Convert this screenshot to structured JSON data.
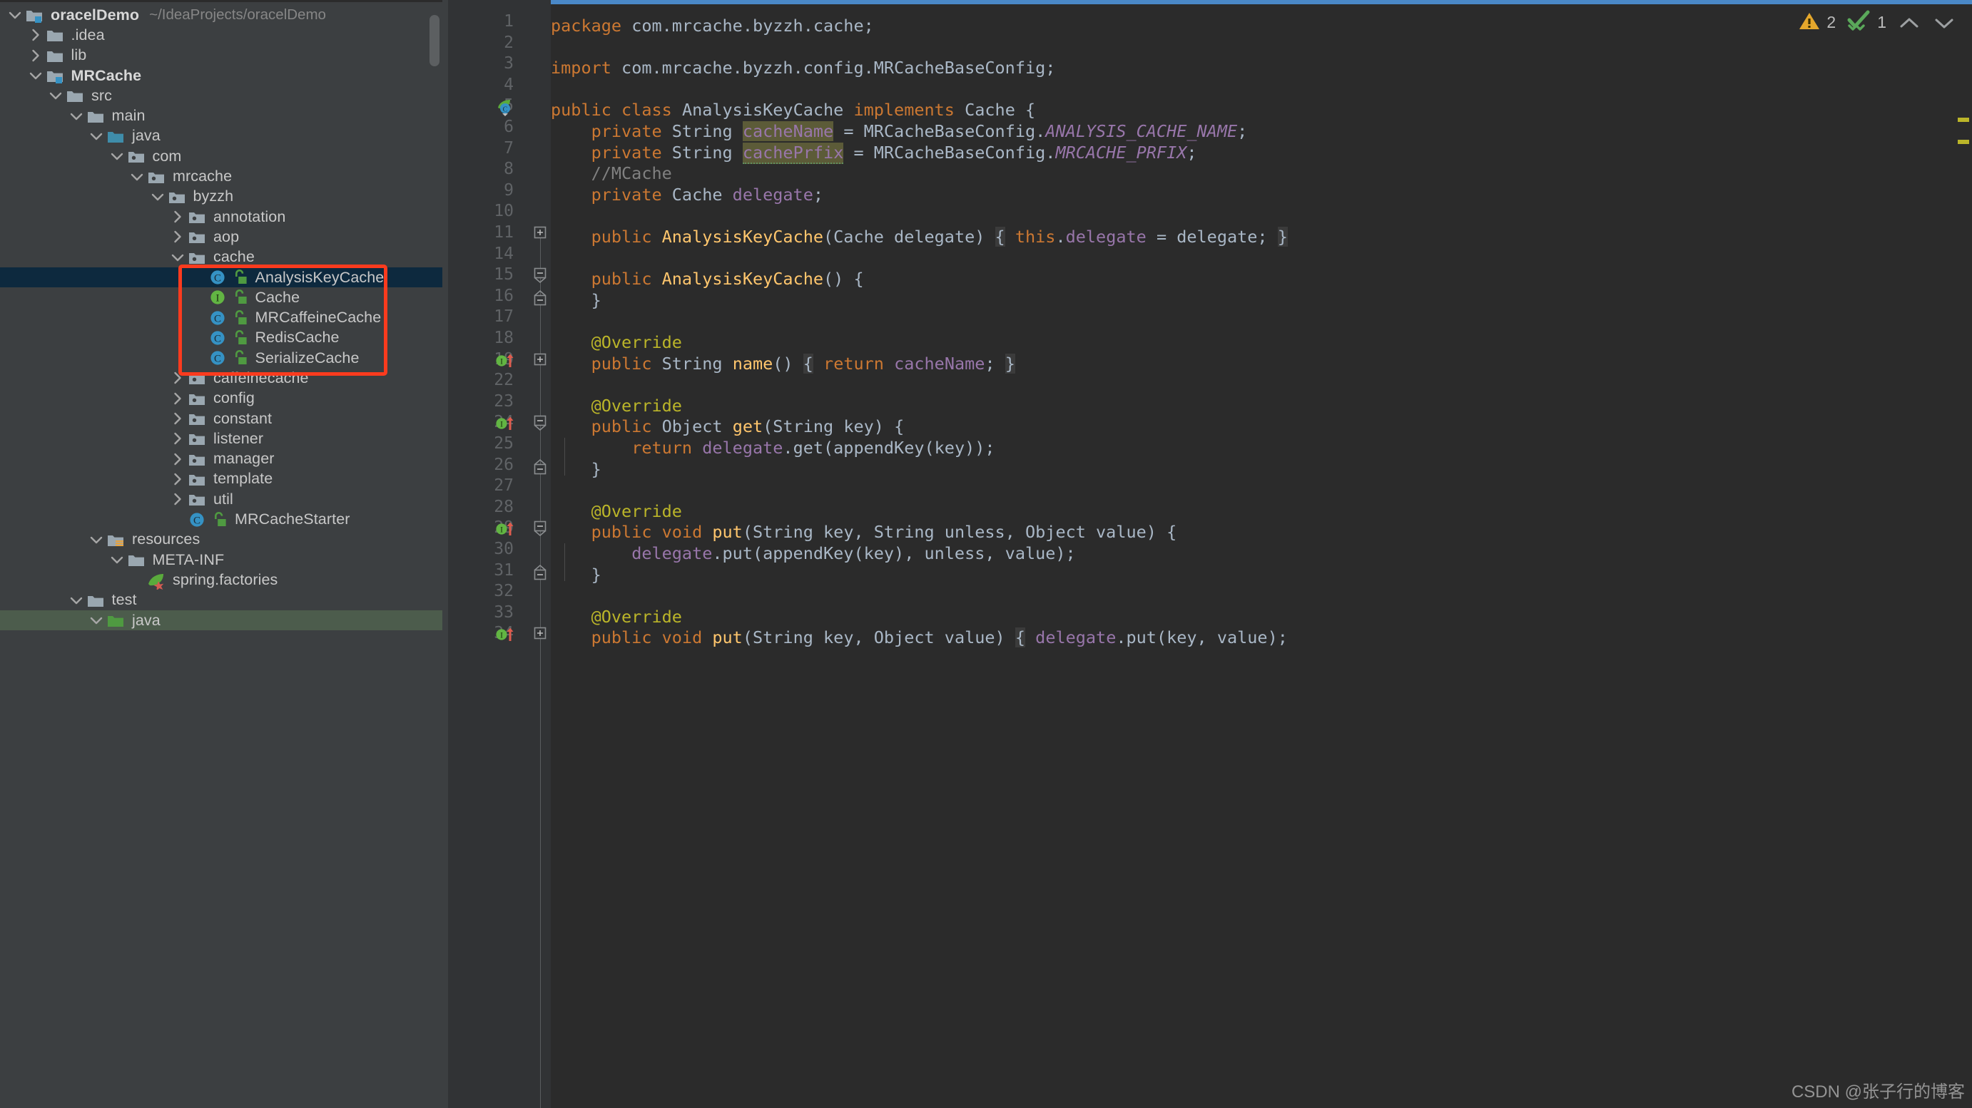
{
  "project": {
    "name": "oracelDemo",
    "path": "~/IdeaProjects/oracelDemo",
    "tree": [
      {
        "label": "oracelDemo",
        "path": "~/IdeaProjects/oracelDemo",
        "depth": 0,
        "icon": "module-folder-icon",
        "twisty": "down",
        "bold": true
      },
      {
        "label": ".idea",
        "depth": 1,
        "icon": "folder-icon",
        "twisty": "right"
      },
      {
        "label": "lib",
        "depth": 1,
        "icon": "folder-icon",
        "twisty": "right"
      },
      {
        "label": "MRCache",
        "depth": 1,
        "icon": "module-folder-icon",
        "twisty": "down",
        "bold": true
      },
      {
        "label": "src",
        "depth": 2,
        "icon": "folder-icon",
        "twisty": "down"
      },
      {
        "label": "main",
        "depth": 3,
        "icon": "folder-icon",
        "twisty": "down"
      },
      {
        "label": "java",
        "depth": 4,
        "icon": "source-root-icon",
        "twisty": "down"
      },
      {
        "label": "com",
        "depth": 5,
        "icon": "package-icon",
        "twisty": "down"
      },
      {
        "label": "mrcache",
        "depth": 6,
        "icon": "package-icon",
        "twisty": "down"
      },
      {
        "label": "byzzh",
        "depth": 7,
        "icon": "package-icon",
        "twisty": "down"
      },
      {
        "label": "annotation",
        "depth": 8,
        "icon": "package-icon",
        "twisty": "right"
      },
      {
        "label": "aop",
        "depth": 8,
        "icon": "package-icon",
        "twisty": "right"
      },
      {
        "label": "cache",
        "depth": 8,
        "icon": "package-icon",
        "twisty": "down"
      },
      {
        "label": "AnalysisKeyCache",
        "depth": 9,
        "icon": "java-class-icon",
        "lock": true,
        "selected": "blue"
      },
      {
        "label": "Cache",
        "depth": 9,
        "icon": "java-interface-icon",
        "lock": true
      },
      {
        "label": "MRCaffeineCache",
        "depth": 9,
        "icon": "java-class-icon",
        "lock": true
      },
      {
        "label": "RedisCache",
        "depth": 9,
        "icon": "java-class-icon",
        "lock": true
      },
      {
        "label": "SerializeCache",
        "depth": 9,
        "icon": "java-class-icon",
        "lock": true
      },
      {
        "label": "caffeinecache",
        "depth": 8,
        "icon": "package-icon",
        "twisty": "right"
      },
      {
        "label": "config",
        "depth": 8,
        "icon": "package-icon",
        "twisty": "right"
      },
      {
        "label": "constant",
        "depth": 8,
        "icon": "package-icon",
        "twisty": "right"
      },
      {
        "label": "listener",
        "depth": 8,
        "icon": "package-icon",
        "twisty": "right"
      },
      {
        "label": "manager",
        "depth": 8,
        "icon": "package-icon",
        "twisty": "right"
      },
      {
        "label": "template",
        "depth": 8,
        "icon": "package-icon",
        "twisty": "right"
      },
      {
        "label": "util",
        "depth": 8,
        "icon": "package-icon",
        "twisty": "right"
      },
      {
        "label": "MRCacheStarter",
        "depth": 8,
        "icon": "java-class-icon",
        "lock": true
      },
      {
        "label": "resources",
        "depth": 4,
        "icon": "resource-root-icon",
        "twisty": "down"
      },
      {
        "label": "META-INF",
        "depth": 5,
        "icon": "folder-icon",
        "twisty": "down"
      },
      {
        "label": "spring.factories",
        "depth": 6,
        "icon": "spring-factories-icon"
      },
      {
        "label": "test",
        "depth": 3,
        "icon": "folder-icon",
        "twisty": "down"
      },
      {
        "label": "java",
        "depth": 4,
        "icon": "test-source-root-icon",
        "twisty": "down",
        "selected": "green"
      }
    ],
    "annotation": {
      "type": "red-rectangle",
      "color": "#fb3b1e",
      "targets": [
        "AnalysisKeyCache",
        "Cache",
        "MRCaffeineCache",
        "RedisCache",
        "SerializeCache"
      ]
    }
  },
  "editor": {
    "file": "AnalysisKeyCache.java",
    "inspections": {
      "warning_icon": "warning-triangle-icon",
      "warning_count": "2",
      "ok_icon": "check-mark-icon",
      "ok_count": "1",
      "up_icon": "chevron-up-icon",
      "down_icon": "chevron-down-icon"
    },
    "line_numbers": [
      "1",
      "2",
      "3",
      "4",
      "5",
      "6",
      "7",
      "8",
      "9",
      "10",
      "11",
      "14",
      "15",
      "16",
      "17",
      "18",
      "19",
      "22",
      "23",
      "24",
      "25",
      "26",
      "27",
      "28",
      "29",
      "30",
      "31",
      "32",
      "33",
      "34"
    ],
    "lines": [
      {
        "n": "1",
        "segs": [
          {
            "t": "package ",
            "c": "kw"
          },
          {
            "t": "com.mrcache.byzzh.cache;",
            "c": "pl"
          }
        ]
      },
      {
        "n": "2",
        "segs": []
      },
      {
        "n": "3",
        "segs": [
          {
            "t": "import ",
            "c": "kw"
          },
          {
            "t": "com.mrcache.byzzh.config.MRCacheBaseConfig;",
            "c": "pl"
          }
        ]
      },
      {
        "n": "4",
        "segs": []
      },
      {
        "n": "5",
        "segs": [
          {
            "t": "public class ",
            "c": "kw"
          },
          {
            "t": "AnalysisKeyCache ",
            "c": "pl"
          },
          {
            "t": "implements ",
            "c": "kw"
          },
          {
            "t": "Cache {",
            "c": "pl"
          }
        ],
        "gutter": "spring-bean-icon"
      },
      {
        "n": "6",
        "segs": [
          {
            "t": "    ",
            "c": "pl"
          },
          {
            "t": "private ",
            "c": "kw"
          },
          {
            "t": "String ",
            "c": "pl"
          },
          {
            "t": "cacheName",
            "c": "fld hl"
          },
          {
            "t": " = MRCacheBaseConfig.",
            "c": "pl"
          },
          {
            "t": "ANALYSIS_CACHE_NAME",
            "c": "cst"
          },
          {
            "t": ";",
            "c": "pl"
          }
        ]
      },
      {
        "n": "7",
        "segs": [
          {
            "t": "    ",
            "c": "pl"
          },
          {
            "t": "private ",
            "c": "kw"
          },
          {
            "t": "String ",
            "c": "pl"
          },
          {
            "t": "cachePrfix",
            "c": "fld hl sq"
          },
          {
            "t": " = MRCacheBaseConfig.",
            "c": "pl"
          },
          {
            "t": "MRCACHE_PRFIX",
            "c": "cst"
          },
          {
            "t": ";",
            "c": "pl"
          }
        ]
      },
      {
        "n": "8",
        "segs": [
          {
            "t": "    //MCache",
            "c": "cmt"
          }
        ]
      },
      {
        "n": "9",
        "segs": [
          {
            "t": "    ",
            "c": "pl"
          },
          {
            "t": "private ",
            "c": "kw"
          },
          {
            "t": "Cache ",
            "c": "pl"
          },
          {
            "t": "delegate",
            "c": "fld"
          },
          {
            "t": ";",
            "c": "pl"
          }
        ]
      },
      {
        "n": "10",
        "segs": []
      },
      {
        "n": "11",
        "segs": [
          {
            "t": "    ",
            "c": "pl"
          },
          {
            "t": "public ",
            "c": "kw"
          },
          {
            "t": "AnalysisKeyCache",
            "c": "mth"
          },
          {
            "t": "(Cache delegate) ",
            "c": "pl"
          },
          {
            "t": "{",
            "c": "pl br"
          },
          {
            "t": " ",
            "c": "pl"
          },
          {
            "t": "this",
            "c": "kw"
          },
          {
            "t": ".",
            "c": "pl"
          },
          {
            "t": "delegate",
            "c": "fld"
          },
          {
            "t": " = delegate; ",
            "c": "pl"
          },
          {
            "t": "}",
            "c": "pl br"
          }
        ],
        "fold": "plus"
      },
      {
        "n": "14",
        "segs": []
      },
      {
        "n": "15",
        "segs": [
          {
            "t": "    ",
            "c": "pl"
          },
          {
            "t": "public ",
            "c": "kw"
          },
          {
            "t": "AnalysisKeyCache",
            "c": "mth"
          },
          {
            "t": "() {",
            "c": "pl"
          }
        ],
        "fold": "collapse-top"
      },
      {
        "n": "16",
        "segs": [
          {
            "t": "    }",
            "c": "pl"
          }
        ],
        "fold": "collapse-bottom"
      },
      {
        "n": "17",
        "segs": []
      },
      {
        "n": "18",
        "segs": [
          {
            "t": "    @Override",
            "c": "ann"
          }
        ]
      },
      {
        "n": "19",
        "segs": [
          {
            "t": "    ",
            "c": "pl"
          },
          {
            "t": "public ",
            "c": "kw"
          },
          {
            "t": "String ",
            "c": "pl"
          },
          {
            "t": "name",
            "c": "mth"
          },
          {
            "t": "() ",
            "c": "pl"
          },
          {
            "t": "{",
            "c": "pl br"
          },
          {
            "t": " ",
            "c": "pl"
          },
          {
            "t": "return ",
            "c": "kw"
          },
          {
            "t": "cacheName",
            "c": "fld"
          },
          {
            "t": "; ",
            "c": "pl"
          },
          {
            "t": "}",
            "c": "pl br"
          }
        ],
        "gutter": "implementing-method-icon",
        "fold": "plus"
      },
      {
        "n": "22",
        "segs": []
      },
      {
        "n": "23",
        "segs": [
          {
            "t": "    @Override",
            "c": "ann"
          }
        ]
      },
      {
        "n": "24",
        "segs": [
          {
            "t": "    ",
            "c": "pl"
          },
          {
            "t": "public ",
            "c": "kw"
          },
          {
            "t": "Object ",
            "c": "pl"
          },
          {
            "t": "get",
            "c": "mth"
          },
          {
            "t": "(String key) {",
            "c": "pl"
          }
        ],
        "gutter": "implementing-method-icon",
        "fold": "collapse-top"
      },
      {
        "n": "25",
        "segs": [
          {
            "t": "        ",
            "c": "pl"
          },
          {
            "t": "return ",
            "c": "kw"
          },
          {
            "t": "delegate",
            "c": "fld"
          },
          {
            "t": ".get(appendKey(key));",
            "c": "pl"
          }
        ]
      },
      {
        "n": "26",
        "segs": [
          {
            "t": "    }",
            "c": "pl"
          }
        ],
        "fold": "collapse-bottom"
      },
      {
        "n": "27",
        "segs": []
      },
      {
        "n": "28",
        "segs": [
          {
            "t": "    @Override",
            "c": "ann"
          }
        ]
      },
      {
        "n": "29",
        "segs": [
          {
            "t": "    ",
            "c": "pl"
          },
          {
            "t": "public ",
            "c": "kw"
          },
          {
            "t": "void ",
            "c": "kw"
          },
          {
            "t": "put",
            "c": "mth"
          },
          {
            "t": "(String key, String unless, Object value) {",
            "c": "pl"
          }
        ],
        "gutter": "implementing-method-icon",
        "fold": "collapse-top"
      },
      {
        "n": "30",
        "segs": [
          {
            "t": "        ",
            "c": "pl"
          },
          {
            "t": "delegate",
            "c": "fld"
          },
          {
            "t": ".put(appendKey(key), unless, value);",
            "c": "pl"
          }
        ]
      },
      {
        "n": "31",
        "segs": [
          {
            "t": "    }",
            "c": "pl"
          }
        ],
        "fold": "collapse-bottom"
      },
      {
        "n": "32",
        "segs": []
      },
      {
        "n": "33",
        "segs": [
          {
            "t": "    @Override",
            "c": "ann"
          }
        ]
      },
      {
        "n": "34",
        "segs": [
          {
            "t": "    ",
            "c": "pl"
          },
          {
            "t": "public ",
            "c": "kw"
          },
          {
            "t": "void ",
            "c": "kw"
          },
          {
            "t": "put",
            "c": "mth"
          },
          {
            "t": "(String key, Object value) ",
            "c": "pl"
          },
          {
            "t": "{",
            "c": "pl br"
          },
          {
            "t": " ",
            "c": "pl"
          },
          {
            "t": "delegate",
            "c": "fld"
          },
          {
            "t": ".put(key, value);",
            "c": "pl"
          }
        ],
        "gutter": "implementing-method-icon",
        "fold": "plus"
      }
    ]
  },
  "watermark": "CSDN @张子行的博客",
  "colors": {
    "background": "#3c3f41",
    "editor_background": "#2b2b2b",
    "selection_blue": "#0d293e",
    "selection_green": "#4c5c4c",
    "annotation_red": "#fb3b1e",
    "keyword_orange": "#cc7832",
    "plain_text": "#a9b7c6",
    "field_purple": "#9876aa",
    "method_yellow": "#ffc66d",
    "annotation_yellow": "#bbb529",
    "comment_gray": "#808080",
    "accent_blue": "#4a88c7"
  }
}
